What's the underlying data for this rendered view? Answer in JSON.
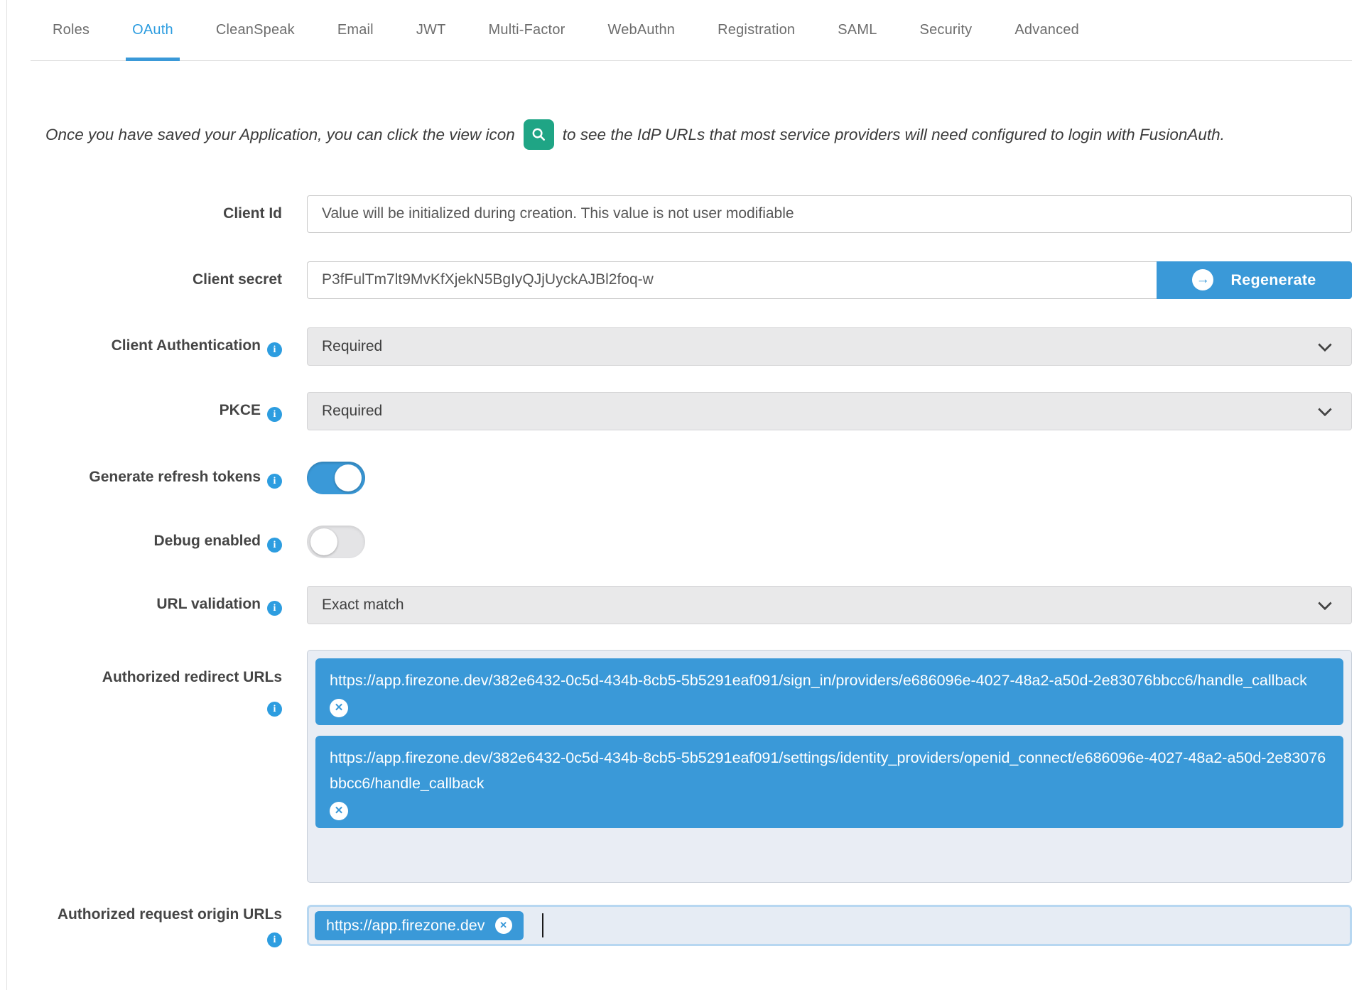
{
  "colors": {
    "accent_blue": "#3a99d8",
    "info_blue": "#2d9de0",
    "icon_green": "#1fa585"
  },
  "icons": {
    "remove_x": "✕",
    "arrow_right": "→",
    "info": "i"
  },
  "tabs": [
    {
      "label": "Roles",
      "active": false
    },
    {
      "label": "OAuth",
      "active": true
    },
    {
      "label": "CleanSpeak",
      "active": false
    },
    {
      "label": "Email",
      "active": false
    },
    {
      "label": "JWT",
      "active": false
    },
    {
      "label": "Multi-Factor",
      "active": false
    },
    {
      "label": "WebAuthn",
      "active": false
    },
    {
      "label": "Registration",
      "active": false
    },
    {
      "label": "SAML",
      "active": false
    },
    {
      "label": "Security",
      "active": false
    },
    {
      "label": "Advanced",
      "active": false
    }
  ],
  "intro": {
    "text_before": "Once you have saved your Application, you can click the view icon",
    "text_after": "to see the IdP URLs that most service providers will need configured to login with FusionAuth."
  },
  "form": {
    "client_id": {
      "label": "Client Id",
      "value": "Value will be initialized during creation. This value is not user modifiable"
    },
    "client_secret": {
      "label": "Client secret",
      "value": "P3fFulTm7lt9MvKfXjekN5BgIyQJjUyckAJBl2foq-w",
      "regenerate_label": "Regenerate"
    },
    "client_authentication": {
      "label": "Client Authentication",
      "value": "Required"
    },
    "pkce": {
      "label": "PKCE",
      "value": "Required"
    },
    "generate_refresh_tokens": {
      "label": "Generate refresh tokens",
      "enabled": true
    },
    "debug_enabled": {
      "label": "Debug enabled",
      "enabled": false
    },
    "url_validation": {
      "label": "URL validation",
      "value": "Exact match"
    },
    "authorized_redirect_urls": {
      "label": "Authorized redirect URLs",
      "urls": [
        "https://app.firezone.dev/382e6432-0c5d-434b-8cb5-5b5291eaf091/sign_in/providers/e686096e-4027-48a2-a50d-2e83076bbcc6/handle_callback",
        "https://app.firezone.dev/382e6432-0c5d-434b-8cb5-5b5291eaf091/settings/identity_providers/openid_connect/e686096e-4027-48a2-a50d-2e83076bbcc6/handle_callback"
      ]
    },
    "authorized_request_origin_urls": {
      "label": "Authorized request origin URLs",
      "urls": [
        "https://app.firezone.dev"
      ]
    }
  }
}
